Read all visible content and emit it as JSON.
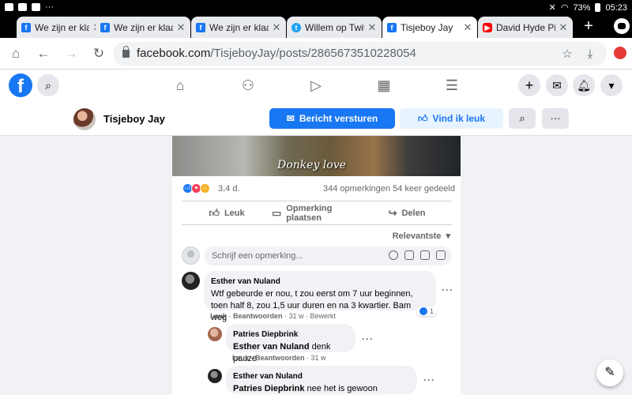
{
  "status_bar": {
    "battery": "73%",
    "time": "05:23"
  },
  "tabs": [
    {
      "title": "We zijn er klaar",
      "favicon": "facebook-favicon",
      "color": "#1877f2"
    },
    {
      "title": "We zijn er klaar",
      "favicon": "facebook-favicon",
      "color": "#1877f2"
    },
    {
      "title": "We zijn er klaar",
      "favicon": "facebook-favicon",
      "color": "#1877f2"
    },
    {
      "title": "Willem op Twitter",
      "favicon": "twitter-favicon",
      "color": "#1da1f2"
    },
    {
      "title": "Tisjeboy Jay",
      "favicon": "facebook-favicon",
      "color": "#1877f2"
    },
    {
      "title": "David Hyde Pierce",
      "favicon": "youtube-favicon",
      "color": "#ff0000"
    }
  ],
  "address_bar": {
    "host": "facebook.com",
    "path": "/TisjeboyJay/posts/2865673510228054"
  },
  "page": {
    "name": "Tisjeboy Jay",
    "message_button": "Bericht versturen",
    "like_button": "Vind ik leuk"
  },
  "post": {
    "image_caption": "Donkey love",
    "reactions_count": "3,4 d.",
    "comments_count": "344 opmerkingen",
    "shares_count": "54 keer gedeeld",
    "actions": {
      "like": "Leuk",
      "comment": "Opmerking plaatsen",
      "share": "Delen"
    },
    "sort": "Relevantste",
    "compose_placeholder": "Schrijf een opmerking..."
  },
  "comments": [
    {
      "author": "Esther van Nuland",
      "text": "Wtf gebeurde er nou, t zou eerst om 7 uur beginnen, toen half 8, zou 1,5 uur duren en na 3 kwartier. Bam weg",
      "like": "Leuk",
      "reply": "Beantwoorden",
      "time": "31 w",
      "edited": "Bewerkt",
      "reaction_count": "1"
    },
    {
      "author": "Patries Diepbrink",
      "mention": "Esther van Nuland",
      "text": " denk pauze",
      "like": "Leuk",
      "reply": "Beantwoorden",
      "time": "31 w"
    },
    {
      "author": "Esther van Nuland",
      "mention": "Patries Diepbrink",
      "text": " nee het is gewoon afgelopen"
    }
  ]
}
